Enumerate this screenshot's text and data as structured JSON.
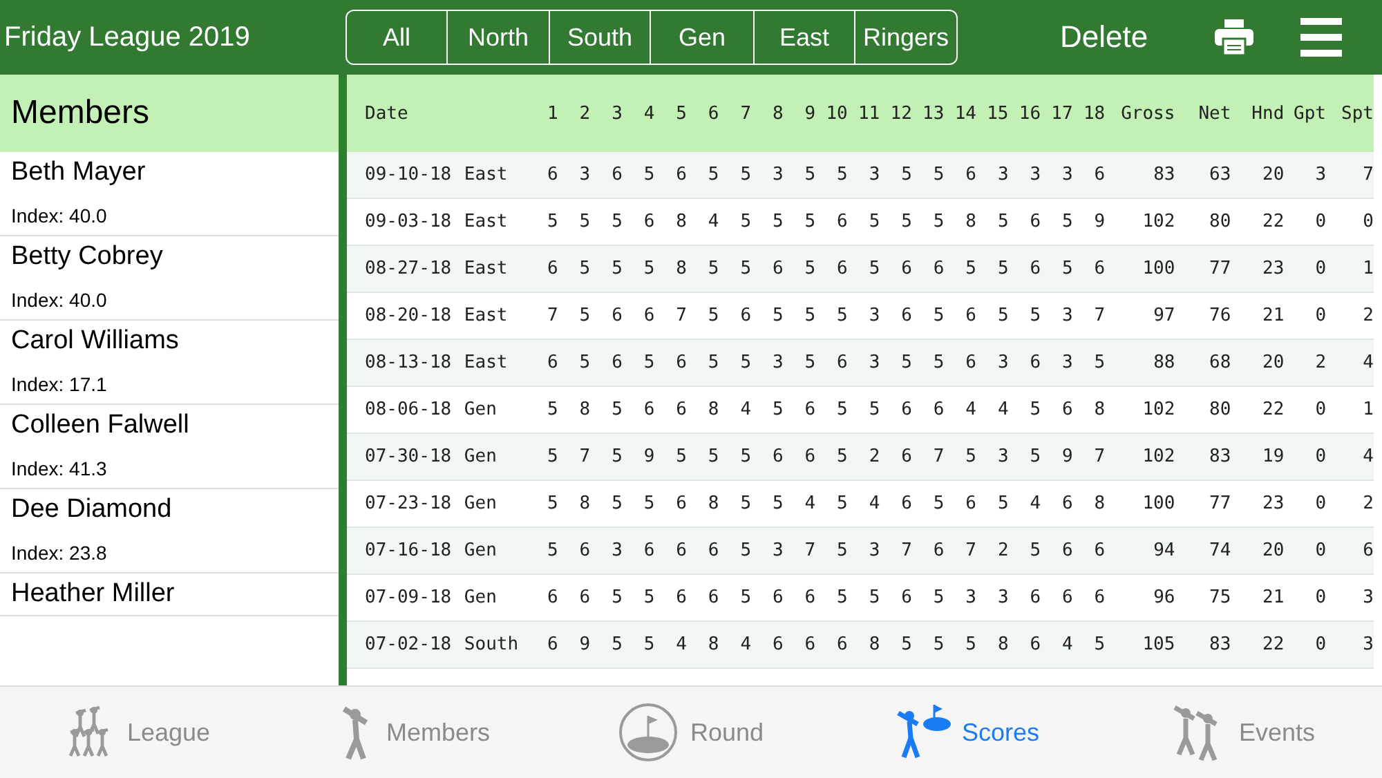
{
  "top_bar": {
    "title": "Friday League 2019",
    "filters": [
      {
        "label": "All",
        "selected": false
      },
      {
        "label": "North",
        "selected": false
      },
      {
        "label": "South",
        "selected": false
      },
      {
        "label": "Gen",
        "selected": false
      },
      {
        "label": "East",
        "selected": false
      },
      {
        "label": "Ringers",
        "selected": false
      }
    ],
    "delete_label": "Delete"
  },
  "sidebar": {
    "title": "Members",
    "items": [
      {
        "name": "Beth Mayer",
        "index": "Index: 40.0"
      },
      {
        "name": "Betty Cobrey",
        "index": "Index: 40.0"
      },
      {
        "name": "Carol Williams",
        "index": "Index: 17.1"
      },
      {
        "name": "Colleen Falwell",
        "index": "Index: 41.3"
      },
      {
        "name": "Dee Diamond",
        "index": "Index: 23.8"
      },
      {
        "name": "Heather Miller"
      }
    ]
  },
  "table": {
    "columns": [
      "Date",
      "",
      "1",
      "2",
      "3",
      "4",
      "5",
      "6",
      "7",
      "8",
      "9",
      "10",
      "11",
      "12",
      "13",
      "14",
      "15",
      "16",
      "17",
      "18",
      "Gross",
      "Net",
      "Hnd",
      "Gpt",
      "Spt"
    ],
    "rows": [
      [
        "09-10-18",
        "East",
        "6",
        "3",
        "6",
        "5",
        "6",
        "5",
        "5",
        "3",
        "5",
        "5",
        "3",
        "5",
        "5",
        "6",
        "3",
        "3",
        "3",
        "6",
        "83",
        "63",
        "20",
        "3",
        "7"
      ],
      [
        "09-03-18",
        "East",
        "5",
        "5",
        "5",
        "6",
        "8",
        "4",
        "5",
        "5",
        "5",
        "6",
        "5",
        "5",
        "5",
        "8",
        "5",
        "6",
        "5",
        "9",
        "102",
        "80",
        "22",
        "0",
        "0"
      ],
      [
        "08-27-18",
        "East",
        "6",
        "5",
        "5",
        "5",
        "8",
        "5",
        "5",
        "6",
        "5",
        "6",
        "5",
        "6",
        "6",
        "5",
        "5",
        "6",
        "5",
        "6",
        "100",
        "77",
        "23",
        "0",
        "1"
      ],
      [
        "08-20-18",
        "East",
        "7",
        "5",
        "6",
        "6",
        "7",
        "5",
        "6",
        "5",
        "5",
        "5",
        "3",
        "6",
        "5",
        "6",
        "5",
        "5",
        "3",
        "7",
        "97",
        "76",
        "21",
        "0",
        "2"
      ],
      [
        "08-13-18",
        "East",
        "6",
        "5",
        "6",
        "5",
        "6",
        "5",
        "5",
        "3",
        "5",
        "6",
        "3",
        "5",
        "5",
        "6",
        "3",
        "6",
        "3",
        "5",
        "88",
        "68",
        "20",
        "2",
        "4"
      ],
      [
        "08-06-18",
        "Gen",
        "5",
        "8",
        "5",
        "6",
        "6",
        "8",
        "4",
        "5",
        "6",
        "5",
        "5",
        "6",
        "6",
        "4",
        "4",
        "5",
        "6",
        "8",
        "102",
        "80",
        "22",
        "0",
        "1"
      ],
      [
        "07-30-18",
        "Gen",
        "5",
        "7",
        "5",
        "9",
        "5",
        "5",
        "5",
        "6",
        "6",
        "5",
        "2",
        "6",
        "7",
        "5",
        "3",
        "5",
        "9",
        "7",
        "102",
        "83",
        "19",
        "0",
        "4"
      ],
      [
        "07-23-18",
        "Gen",
        "5",
        "8",
        "5",
        "5",
        "6",
        "8",
        "5",
        "5",
        "4",
        "5",
        "4",
        "6",
        "5",
        "6",
        "5",
        "4",
        "6",
        "8",
        "100",
        "77",
        "23",
        "0",
        "2"
      ],
      [
        "07-16-18",
        "Gen",
        "5",
        "6",
        "3",
        "6",
        "6",
        "6",
        "5",
        "3",
        "7",
        "5",
        "3",
        "7",
        "6",
        "7",
        "2",
        "5",
        "6",
        "6",
        "94",
        "74",
        "20",
        "0",
        "6"
      ],
      [
        "07-09-18",
        "Gen",
        "6",
        "6",
        "5",
        "5",
        "6",
        "6",
        "5",
        "6",
        "6",
        "5",
        "5",
        "6",
        "5",
        "3",
        "3",
        "6",
        "6",
        "6",
        "96",
        "75",
        "21",
        "0",
        "3"
      ],
      [
        "07-02-18",
        "South",
        "6",
        "9",
        "5",
        "5",
        "4",
        "8",
        "4",
        "6",
        "6",
        "6",
        "8",
        "5",
        "5",
        "5",
        "8",
        "6",
        "4",
        "5",
        "105",
        "83",
        "22",
        "0",
        "3"
      ]
    ]
  },
  "tab_bar": {
    "items": [
      {
        "label": "League",
        "kind": "league",
        "selected": false
      },
      {
        "label": "Members",
        "kind": "members",
        "selected": false
      },
      {
        "label": "Round",
        "kind": "round",
        "selected": false
      },
      {
        "label": "Scores",
        "kind": "scores",
        "selected": true
      },
      {
        "label": "Events",
        "kind": "events",
        "selected": false
      }
    ]
  }
}
